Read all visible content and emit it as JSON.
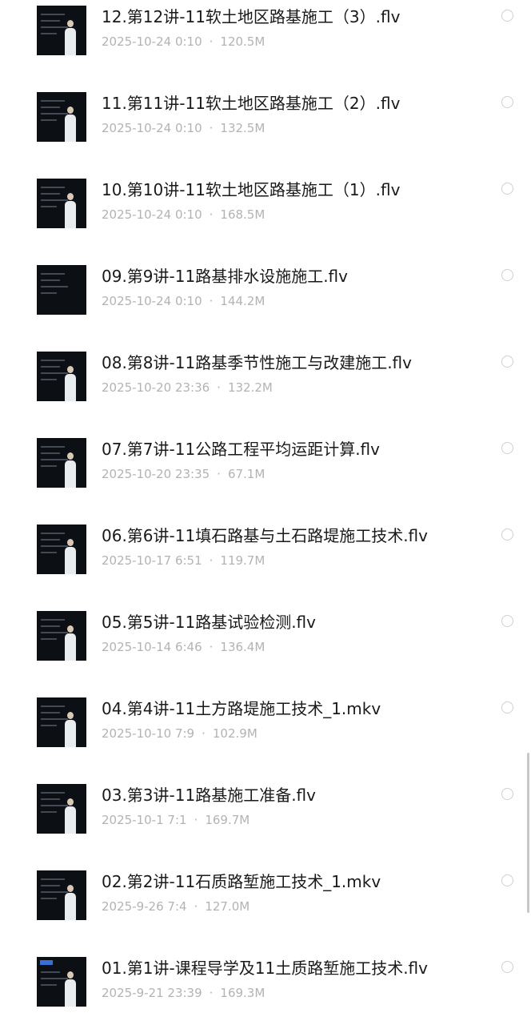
{
  "files": [
    {
      "name": "12.第12讲-11软土地区路基施工（3）.flv",
      "date": "2025-10-24 0:10",
      "size": "120.5M"
    },
    {
      "name": "11.第11讲-11软土地区路基施工（2）.flv",
      "date": "2025-10-24 0:10",
      "size": "132.5M"
    },
    {
      "name": "10.第10讲-11软土地区路基施工（1）.flv",
      "date": "2025-10-24 0:10",
      "size": "168.5M"
    },
    {
      "name": "09.第9讲-11路基排水设施施工.flv",
      "date": "2025-10-24 0:10",
      "size": "144.2M"
    },
    {
      "name": "08.第8讲-11路基季节性施工与改建施工.flv",
      "date": "2025-10-20 23:36",
      "size": "132.2M"
    },
    {
      "name": "07.第7讲-11公路工程平均运距计算.flv",
      "date": "2025-10-20 23:35",
      "size": "67.1M"
    },
    {
      "name": "06.第6讲-11填石路基与土石路堤施工技术.flv",
      "date": "2025-10-17 6:51",
      "size": "119.7M"
    },
    {
      "name": "05.第5讲-11路基试验检测.flv",
      "date": "2025-10-14 6:46",
      "size": "136.4M"
    },
    {
      "name": "04.第4讲-11土方路堤施工技术_1.mkv",
      "date": "2025-10-10 7:9",
      "size": "102.9M"
    },
    {
      "name": "03.第3讲-11路基施工准备.flv",
      "date": "2025-10-1 7:1",
      "size": "169.7M"
    },
    {
      "name": "02.第2讲-11石质路堑施工技术_1.mkv",
      "date": "2025-9-26 7:4",
      "size": "127.0M"
    },
    {
      "name": "01.第1讲-课程导学及11土质路堑施工技术.flv",
      "date": "2025-9-21 23:39",
      "size": "169.3M"
    }
  ],
  "meta_separator": "·",
  "colors": {
    "background": "#ffffff",
    "title_text": "#1a1a1a",
    "meta_text": "#b3b3b3",
    "radio_border": "#cfcfcf",
    "thumbnail_bg": "#0c0f14"
  },
  "icons": {
    "thumbnail": "video-thumbnail-icon",
    "select": "radio-unselected-icon"
  }
}
